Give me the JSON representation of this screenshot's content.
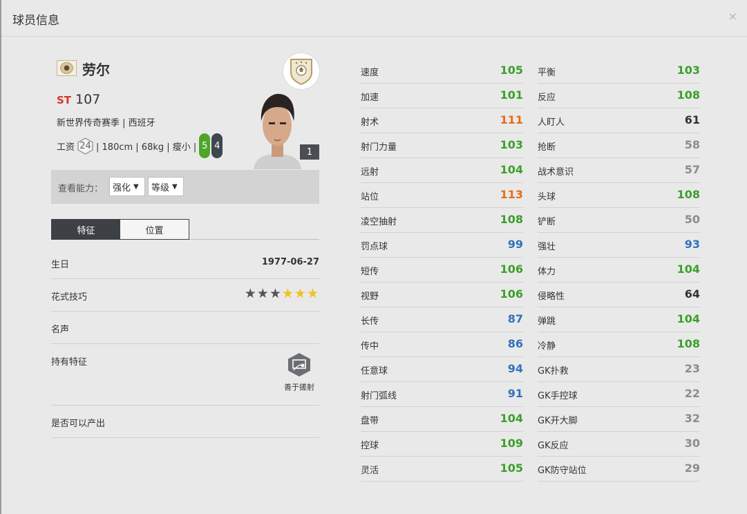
{
  "window": {
    "title": "球员信息",
    "close": "×"
  },
  "player": {
    "name": "劳尔",
    "position": "ST",
    "overall": "107",
    "season_line": "新世界传奇赛季 | 西班牙",
    "salary_label": "工资",
    "salary": "24",
    "physique": "| 180cm | 68kg | 瘦小 |",
    "left_foot": "5",
    "right_foot": "4",
    "level": "1"
  },
  "view": {
    "label": "查看能力：",
    "enhance": "强化",
    "grade": "等级"
  },
  "tabs": [
    "特征",
    "位置"
  ],
  "traits": {
    "birthday_label": "生日",
    "birthday": "1977-06-27",
    "skill_label": "花式技巧",
    "skill_stars_filled": 3,
    "skill_stars_total": 6,
    "fame_label": "名声",
    "traits_label": "持有特征",
    "trait_name": "善于搓射",
    "tradable_label": "是否可以产出"
  },
  "colors": {
    "green": "#3aa02a",
    "orange": "#e56d17",
    "blue": "#3172b9",
    "black": "#333333",
    "gray": "#8c8c8c"
  },
  "stats_left": [
    {
      "name": "速度",
      "value": "105",
      "color": "green"
    },
    {
      "name": "加速",
      "value": "101",
      "color": "green"
    },
    {
      "name": "射术",
      "value": "111",
      "color": "orange"
    },
    {
      "name": "射门力量",
      "value": "103",
      "color": "green"
    },
    {
      "name": "远射",
      "value": "104",
      "color": "green"
    },
    {
      "name": "站位",
      "value": "113",
      "color": "orange"
    },
    {
      "name": "凌空抽射",
      "value": "108",
      "color": "green"
    },
    {
      "name": "罚点球",
      "value": "99",
      "color": "blue"
    },
    {
      "name": "短传",
      "value": "106",
      "color": "green"
    },
    {
      "name": "视野",
      "value": "106",
      "color": "green"
    },
    {
      "name": "长传",
      "value": "87",
      "color": "blue"
    },
    {
      "name": "传中",
      "value": "86",
      "color": "blue"
    },
    {
      "name": "任意球",
      "value": "94",
      "color": "blue"
    },
    {
      "name": "射门弧线",
      "value": "91",
      "color": "blue"
    },
    {
      "name": "盘带",
      "value": "104",
      "color": "green"
    },
    {
      "name": "控球",
      "value": "109",
      "color": "green"
    },
    {
      "name": "灵活",
      "value": "105",
      "color": "green"
    }
  ],
  "stats_right": [
    {
      "name": "平衡",
      "value": "103",
      "color": "green"
    },
    {
      "name": "反应",
      "value": "108",
      "color": "green"
    },
    {
      "name": "人盯人",
      "value": "61",
      "color": "black"
    },
    {
      "name": "抢断",
      "value": "58",
      "color": "gray"
    },
    {
      "name": "战术意识",
      "value": "57",
      "color": "gray"
    },
    {
      "name": "头球",
      "value": "108",
      "color": "green"
    },
    {
      "name": "铲断",
      "value": "50",
      "color": "gray"
    },
    {
      "name": "强壮",
      "value": "93",
      "color": "blue"
    },
    {
      "name": "体力",
      "value": "104",
      "color": "green"
    },
    {
      "name": "侵略性",
      "value": "64",
      "color": "black"
    },
    {
      "name": "弹跳",
      "value": "104",
      "color": "green"
    },
    {
      "name": "冷静",
      "value": "108",
      "color": "green"
    },
    {
      "name": "GK扑救",
      "value": "23",
      "color": "gray"
    },
    {
      "name": "GK手控球",
      "value": "22",
      "color": "gray"
    },
    {
      "name": "GK开大脚",
      "value": "32",
      "color": "gray"
    },
    {
      "name": "GK反应",
      "value": "30",
      "color": "gray"
    },
    {
      "name": "GK防守站位",
      "value": "29",
      "color": "gray"
    }
  ]
}
